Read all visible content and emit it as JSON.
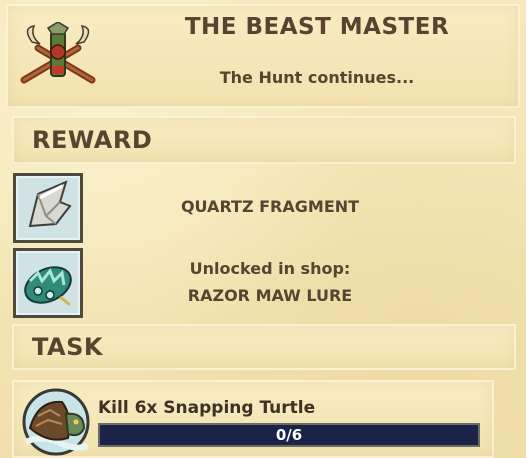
{
  "quest": {
    "title": "THE BEAST MASTER",
    "subtitle": "The Hunt continues..."
  },
  "reward": {
    "section_title": "REWARD",
    "items": [
      {
        "icon": "quartz-fragment-icon",
        "label": "QUARTZ FRAGMENT"
      },
      {
        "icon": "razor-maw-lure-icon",
        "label_line1": "Unlocked in shop:",
        "label_line2": "RAZOR MAW LURE"
      }
    ]
  },
  "task": {
    "section_title": "TASK",
    "icon": "snapping-turtle-icon",
    "description": "Kill 6x Snapping Turtle",
    "progress_text": "0/6",
    "progress_current": 0,
    "progress_total": 6
  },
  "colors": {
    "text": "#5a4330",
    "progress_track": "#1c2348",
    "progress_fill": "#3a4fa0"
  }
}
